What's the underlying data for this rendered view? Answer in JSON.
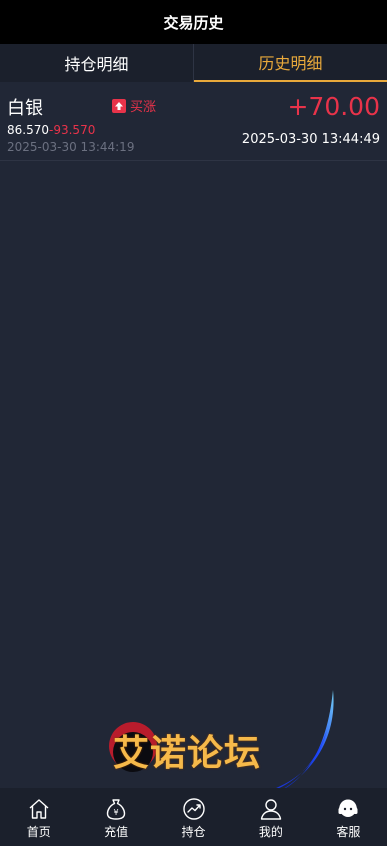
{
  "header": {
    "title": "交易历史"
  },
  "tabs": [
    {
      "label": "持仓明细",
      "active": false
    },
    {
      "label": "历史明细",
      "active": true
    }
  ],
  "record": {
    "name": "白银",
    "direction_label": "买涨",
    "open_price": "86.570",
    "separator": "-",
    "close_price": "93.570",
    "open_time": "2025-03-30 13:44:19",
    "profit": "+70.00",
    "close_time": "2025-03-30 13:44:49"
  },
  "watermark": {
    "text": "艾诺论坛"
  },
  "nav": [
    {
      "label": "首页",
      "icon": "home-icon"
    },
    {
      "label": "充值",
      "icon": "money-bag-icon"
    },
    {
      "label": "持仓",
      "icon": "chart-icon"
    },
    {
      "label": "我的",
      "icon": "user-icon"
    },
    {
      "label": "客服",
      "icon": "headset-icon"
    }
  ],
  "colors": {
    "accent": "#e9a93b",
    "up": "#e8334a",
    "background": "#212736",
    "bar": "#1b202c"
  }
}
